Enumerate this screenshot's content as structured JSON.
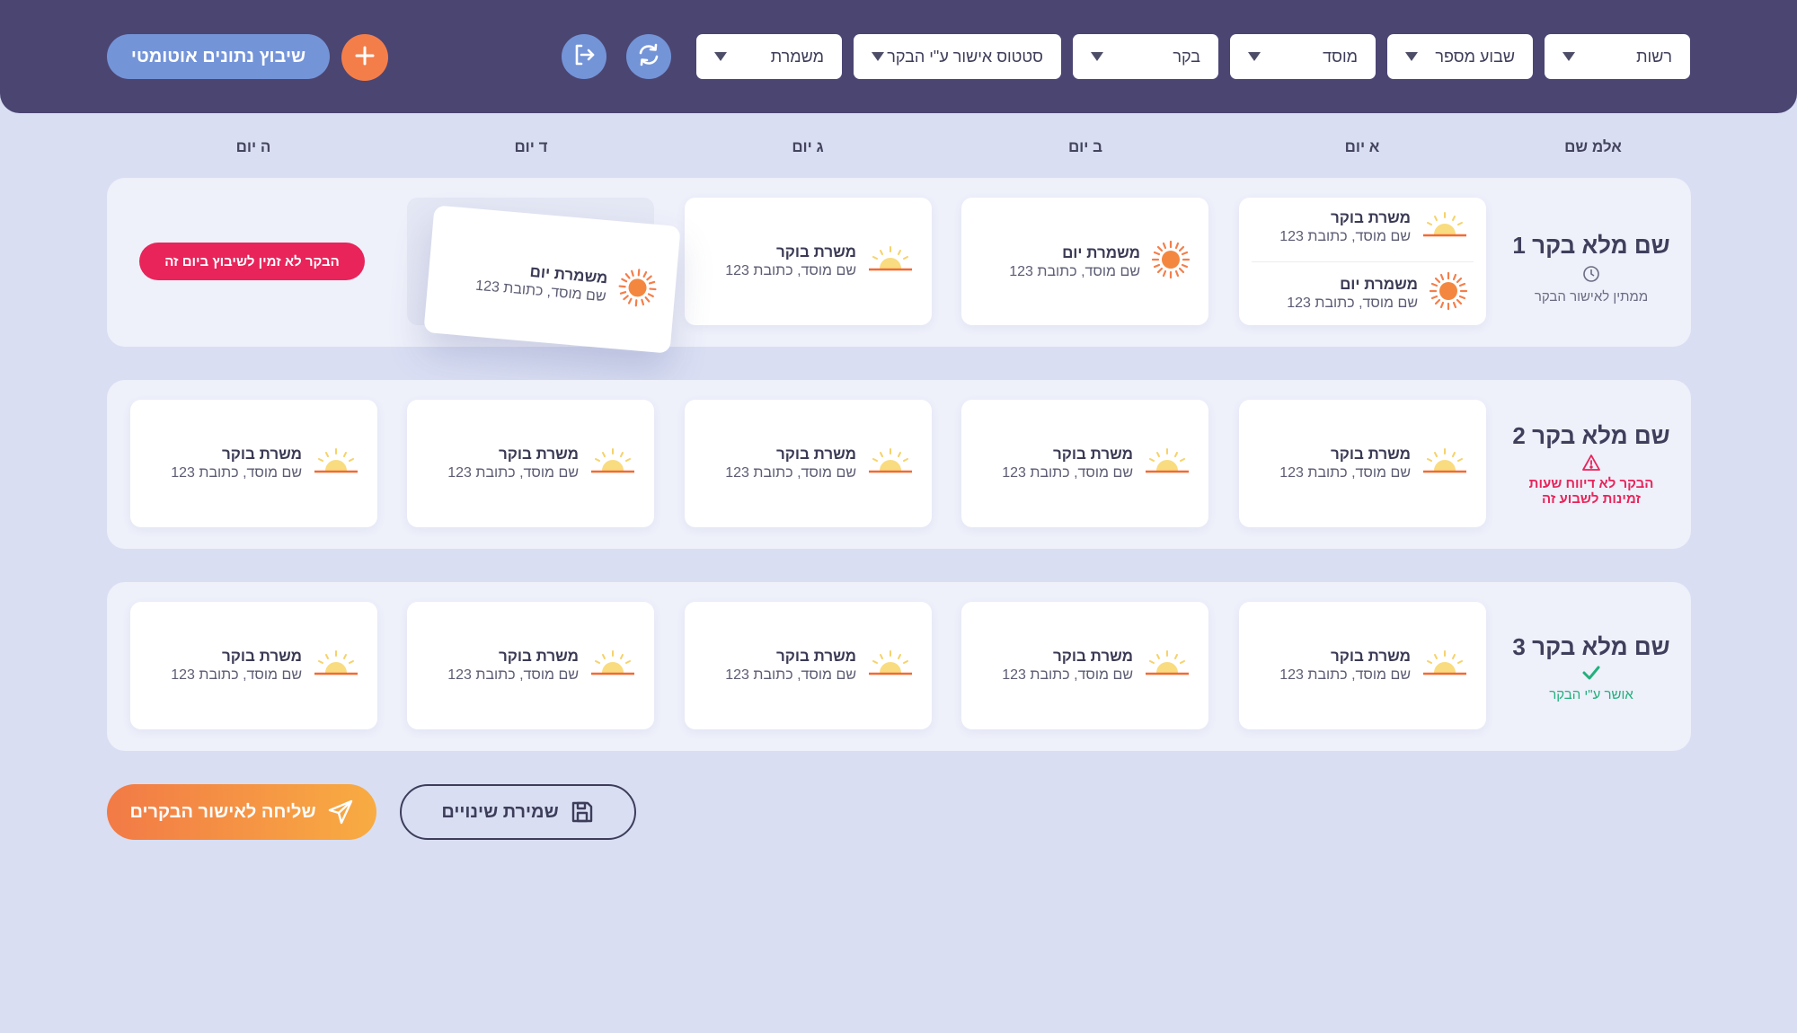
{
  "header": {
    "filters": [
      {
        "label": "רשות"
      },
      {
        "label": "שבוע מספר"
      },
      {
        "label": "מוסד"
      },
      {
        "label": "בקר"
      },
      {
        "label": "סטטוס אישור ע\"י הבקר"
      },
      {
        "label": "משמרת"
      }
    ],
    "auto_schedule_label": "שיבוץ נתונים אוטומטי",
    "icons": [
      "refresh-icon",
      "logout-icon",
      "plus-icon"
    ]
  },
  "columns": [
    "אלמ שם",
    "א יום",
    "ב יום",
    "ג יום",
    "ד יום",
    "ה יום"
  ],
  "rows": [
    {
      "name": "שם מלא בקר 1",
      "status": "ממתין לאישור הבקר",
      "status_icon": "clock-icon",
      "status_color": "#6b6b82",
      "unavailable_label": "הבקר לא זמין לשיבוץ ביום זה",
      "cells": [
        {
          "shifts": [
            {
              "title": "משרת בוקר",
              "subtitle": "שם מוסד, כתובת 123",
              "icon": "sunrise-icon"
            },
            {
              "title": "משמרת יום",
              "subtitle": "שם מוסד, כתובת 123",
              "icon": "sun-icon"
            }
          ]
        },
        {
          "shifts": [
            {
              "title": "משמרת יום",
              "subtitle": "שם מוסד, כתובת 123",
              "icon": "sun-icon"
            }
          ]
        },
        {
          "shifts": [
            {
              "title": "משרת בוקר",
              "subtitle": "שם מוסד, כתובת 123",
              "icon": "sunrise-icon"
            }
          ]
        },
        {
          "shifts": [
            {
              "title": "משמרת יום",
              "subtitle": "שם מוסד, כתובת 123",
              "icon": "sun-icon"
            }
          ],
          "dragging": true
        }
      ]
    },
    {
      "name": "שם מלא בקר 2",
      "status": "הבקר לא דיווח שעות זמינות לשבוע זה",
      "status_line1": "הבקר לא דיווח שעות",
      "status_line2": "זמינות לשבוע זה",
      "status_icon": "warning-icon",
      "status_color": "#e8245a",
      "cells": [
        {
          "shifts": [
            {
              "title": "משרת בוקר",
              "subtitle": "שם מוסד, כתובת 123",
              "icon": "sunrise-icon"
            }
          ]
        },
        {
          "shifts": [
            {
              "title": "משרת בוקר",
              "subtitle": "שם מוסד, כתובת 123",
              "icon": "sunrise-icon"
            }
          ]
        },
        {
          "shifts": [
            {
              "title": "משרת בוקר",
              "subtitle": "שם מוסד, כתובת 123",
              "icon": "sunrise-icon"
            }
          ]
        },
        {
          "shifts": [
            {
              "title": "משרת בוקר",
              "subtitle": "שם מוסד, כתובת 123",
              "icon": "sunrise-icon"
            }
          ]
        },
        {
          "shifts": [
            {
              "title": "משרת בוקר",
              "subtitle": "שם מוסד, כתובת 123",
              "icon": "sunrise-icon"
            }
          ]
        }
      ]
    },
    {
      "name": "שם מלא בקר 3",
      "status": "אושר ע\"י הבקר",
      "status_icon": "check-icon",
      "status_color": "#22b07d",
      "cells": [
        {
          "shifts": [
            {
              "title": "משרת בוקר",
              "subtitle": "שם מוסד, כתובת 123",
              "icon": "sunrise-icon"
            }
          ]
        },
        {
          "shifts": [
            {
              "title": "משרת בוקר",
              "subtitle": "שם מוסד, כתובת 123",
              "icon": "sunrise-icon"
            }
          ]
        },
        {
          "shifts": [
            {
              "title": "משרת בוקר",
              "subtitle": "שם מוסד, כתובת 123",
              "icon": "sunrise-icon"
            }
          ]
        },
        {
          "shifts": [
            {
              "title": "משרת בוקר",
              "subtitle": "שם מוסד, כתובת 123",
              "icon": "sunrise-icon"
            }
          ]
        },
        {
          "shifts": [
            {
              "title": "משרת בוקר",
              "subtitle": "שם מוסד, כתובת 123",
              "icon": "sunrise-icon"
            }
          ]
        }
      ]
    }
  ],
  "footer": {
    "send_label": "שליחה לאישור הבקרים",
    "save_label": "שמירת שינויים"
  },
  "colors": {
    "header_bg": "#4b4572",
    "accent_blue": "#7494d8",
    "accent_orange": "#f47e4a",
    "alert_red": "#e8245a",
    "success_green": "#22b07d"
  }
}
